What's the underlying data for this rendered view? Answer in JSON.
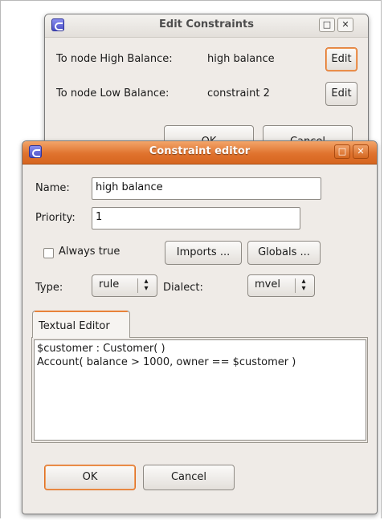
{
  "back_dialog": {
    "title": "Edit Constraints",
    "rows": [
      {
        "label": "To node High Balance:",
        "value": "high balance",
        "button": "Edit"
      },
      {
        "label": "To node Low Balance:",
        "value": "constraint 2",
        "button": "Edit"
      }
    ],
    "ok_label": "OK",
    "cancel_label": "Cancel",
    "minimize_glyph": "□",
    "close_glyph": "✕"
  },
  "front_dialog": {
    "title": "Constraint editor",
    "minimize_glyph": "□",
    "close_glyph": "✕",
    "name_label": "Name:",
    "name_value": "high balance",
    "priority_label": "Priority:",
    "priority_value": "1",
    "always_true_label": "Always true",
    "always_true_checked": false,
    "imports_label": "Imports ...",
    "globals_label": "Globals ...",
    "type_label": "Type:",
    "type_value": "rule",
    "dialect_label": "Dialect:",
    "dialect_value": "mvel",
    "tab_label": "Textual Editor",
    "editor_line1": "$customer : Customer( )",
    "editor_line2": "Account( balance > 1000, owner == $customer )",
    "ok_label": "OK",
    "cancel_label": "Cancel"
  },
  "colors": {
    "accent": "#df6e22",
    "dialog_bg": "#efebe7",
    "titlebar_active": "#e0732e"
  },
  "icons": [
    "app-icon",
    "minimize-icon",
    "close-icon",
    "combo-arrows-icon"
  ]
}
